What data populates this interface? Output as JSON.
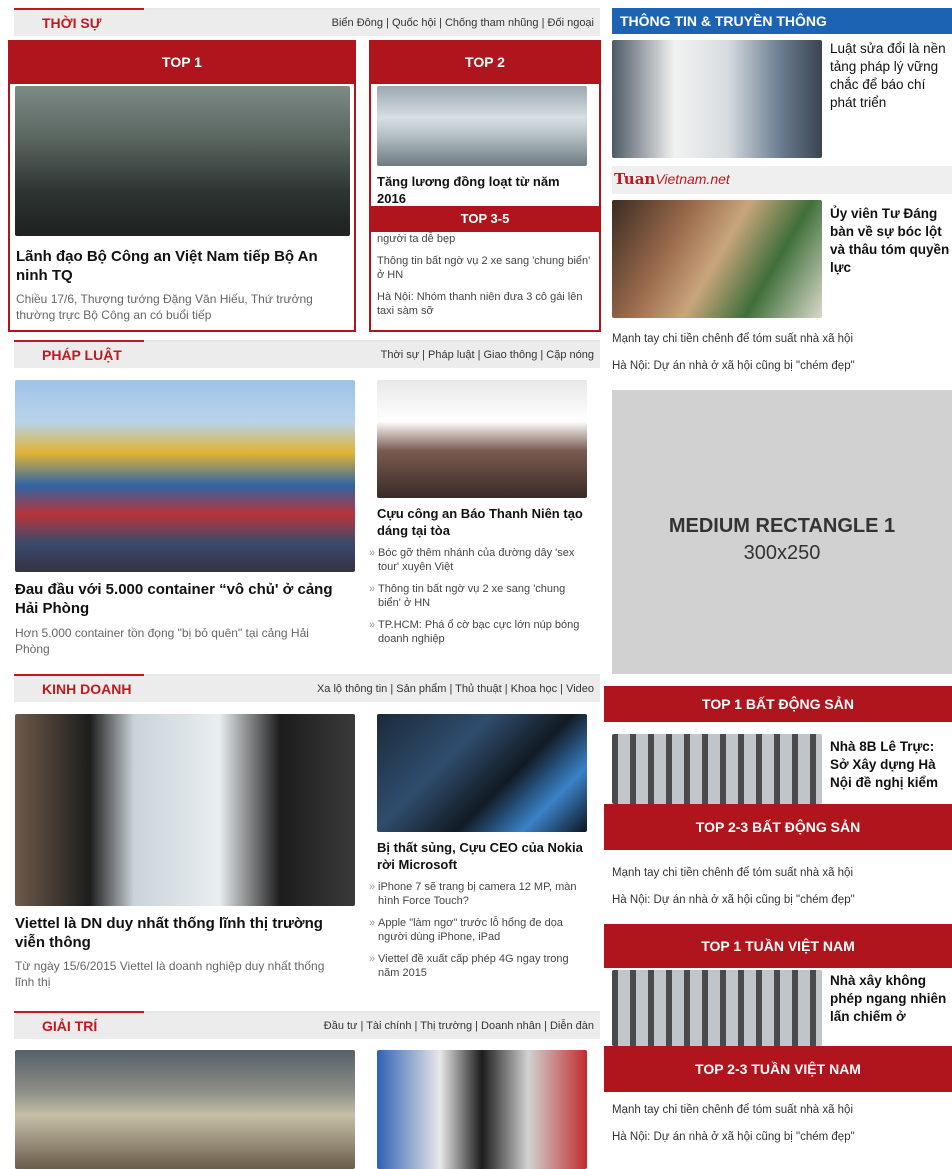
{
  "thoi_su": {
    "title": "THỜI SỰ",
    "subnav": "Biển Đông | Quốc hội | Chống tham nhũng | Đối ngoại",
    "top1": {
      "label": "TOP 1",
      "headline": "Lãnh đạo Bộ Công an Việt Nam tiếp Bộ An ninh TQ",
      "excerpt": "Chiều 17/6, Thượng tướng Đặng Văn Hiếu, Thứ trưởng thường trực Bộ Công an có buổi tiếp"
    },
    "top2": {
      "label": "TOP 2",
      "headline": "Tăng lương đồng loạt từ năm 2016"
    },
    "top35": {
      "label": "TOP 3-5",
      "items": [
        "người ta dễ bẹp",
        "Thông tin bất ngờ vụ 2 xe sang 'chung biển' ở HN",
        "Hà Nội: Nhóm thanh niên đưa 3 cô gái lên taxi sàm sỡ"
      ]
    }
  },
  "phap_luat": {
    "title": "PHÁP LUẬT",
    "subnav": "Thời sự | Pháp luật | Giao thông | Cặp nóng",
    "main": {
      "headline": "Đau đầu với 5.000 container “vô chủ' ở cảng Hải Phòng",
      "excerpt": "Hơn 5.000 container tồn đọng \"bị bỏ quên\" tại cảng Hải Phòng"
    },
    "side": {
      "headline": "Cựu công an Báo Thanh Niên tạo dáng tại tòa",
      "bullets": [
        "Bóc gỡ thêm nhánh của đường dây 'sex tour' xuyên Việt",
        "Thông tin bất ngờ vụ 2 xe sang 'chung biển' ở HN",
        "TP.HCM: Phá ổ cờ bạc cực lớn núp bóng doanh nghiệp"
      ]
    }
  },
  "kinh_doanh": {
    "title": "KINH DOANH",
    "subnav": "Xa lộ thông tin | Sản phẩm | Thủ thuật | Khoa học | Video",
    "main": {
      "headline": "Viettel là DN duy nhất thống lĩnh thị trường viễn thông",
      "excerpt": "Từ ngày 15/6/2015 Viettel là doanh nghiệp duy nhất thống lĩnh thị"
    },
    "side": {
      "headline": "Bị thất sủng, Cựu CEO của Nokia rời Microsoft",
      "bullets": [
        "iPhone 7 sẽ trang bị camera 12 MP, màn hình Force Touch?",
        "Apple \"làm ngơ\" trước lỗ hổng đe dọa người dùng iPhone, iPad",
        "Viettel đề xuất cấp phép 4G ngay trong năm 2015"
      ]
    }
  },
  "giai_tri": {
    "title": "GIẢI TRÍ",
    "subnav": "Đầu tư | Tài chính | Thị trường | Doanh nhân | Diễn đàn"
  },
  "sidebar": {
    "ttt": {
      "title": "THÔNG TIN & TRUYỀN THÔNG",
      "headline": "Luật sửa đổi là nền tảng pháp lý vững chắc để báo chí phát triển"
    },
    "tuan": {
      "logo_main": "Tuan",
      "logo_rest": "Vietnam.net",
      "headline": "Ủy viên Tư Đáng bàn về sự bóc lột và thâu tóm quyền lực",
      "links": [
        "Mạnh tay chi tiền chênh để tóm suất nhà xã hội",
        "Hà Nội: Dự án nhà ở xã hội cũng bị \"chém đẹp\""
      ]
    },
    "ad": {
      "line1": "MEDIUM RECTANGLE 1",
      "line2": "300x250"
    },
    "bds1": {
      "label": "TOP 1 BẤT ĐỘNG SẢN",
      "headline": "Nhà 8B Lê Trực: Sở Xây dựng Hà Nội đề nghị kiểm"
    },
    "bds23": {
      "label": "TOP 2-3 BẤT ĐỘNG SẢN",
      "links": [
        "Mạnh tay chi tiền chênh để tóm suất nhà xã hội",
        "Hà Nội: Dự án nhà ở xã hội cũng bị \"chém đẹp\""
      ]
    },
    "tvn1": {
      "label": "TOP 1 TUẦN VIỆT NAM",
      "headline": "Nhà xây không phép ngang nhiên lấn chiếm ở"
    },
    "tvn23": {
      "label": "TOP 2-3 TUẦN VIỆT NAM",
      "links": [
        "Mạnh tay chi tiền chênh để tóm suất nhà xã hội",
        "Hà Nội: Dự án nhà ở xã hội cũng bị \"chém đẹp\""
      ]
    }
  },
  "colors": {
    "brand_red": "#b0141c",
    "section_red": "#c0181f",
    "blue_header": "#1c64b3"
  }
}
